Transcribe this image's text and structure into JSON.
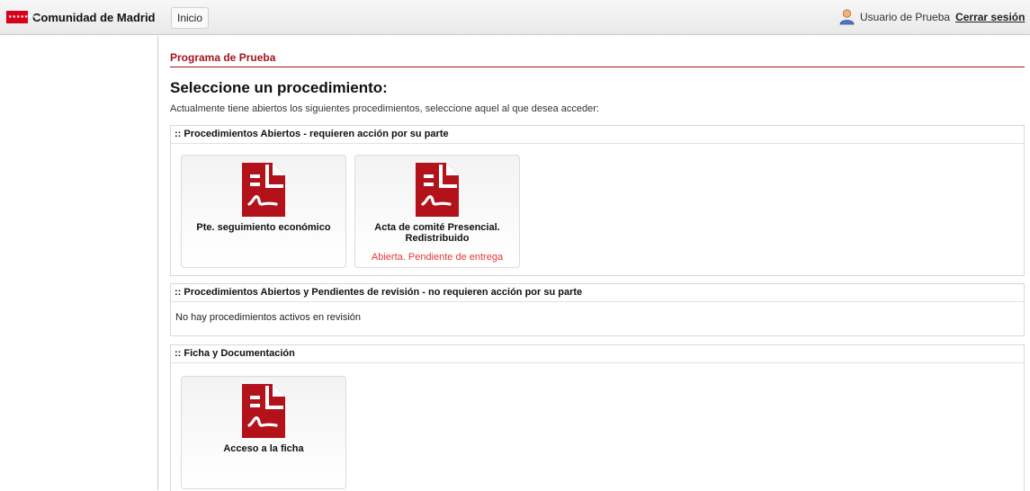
{
  "header": {
    "brand": "Comunidad de Madrid",
    "home_button": "Inicio",
    "user_name": "Usuario de Prueba",
    "logout": "Cerrar sesión"
  },
  "page": {
    "program_title": "Programa de Prueba",
    "heading": "Seleccione un procedimiento:",
    "intro": "Actualmente tiene abiertos los siguientes procedimientos, seleccione aquel al que desea acceder:"
  },
  "sections": [
    {
      "title": ":: Procedimientos Abiertos - requieren acción por su parte",
      "cards": [
        {
          "title": "Pte. seguimiento económico",
          "status": ""
        },
        {
          "title": "Acta de comité Presencial. Redistribuido",
          "status": "Abierta. Pendiente de entrega"
        }
      ]
    },
    {
      "title": ":: Procedimientos Abiertos y Pendientes de revisión - no requieren acción por su parte",
      "empty_text": "No hay procedimientos activos en revisión"
    },
    {
      "title": ":: Ficha y Documentación",
      "cards": [
        {
          "title": "Acceso a la ficha",
          "status": ""
        }
      ]
    }
  ],
  "colors": {
    "brand_red": "#d6001c",
    "accent": "#a3141d",
    "icon": "#b3121b",
    "status": "#e53935"
  },
  "icons": {
    "card_icon": "document-signature-icon",
    "user_icon": "user-avatar-icon"
  }
}
